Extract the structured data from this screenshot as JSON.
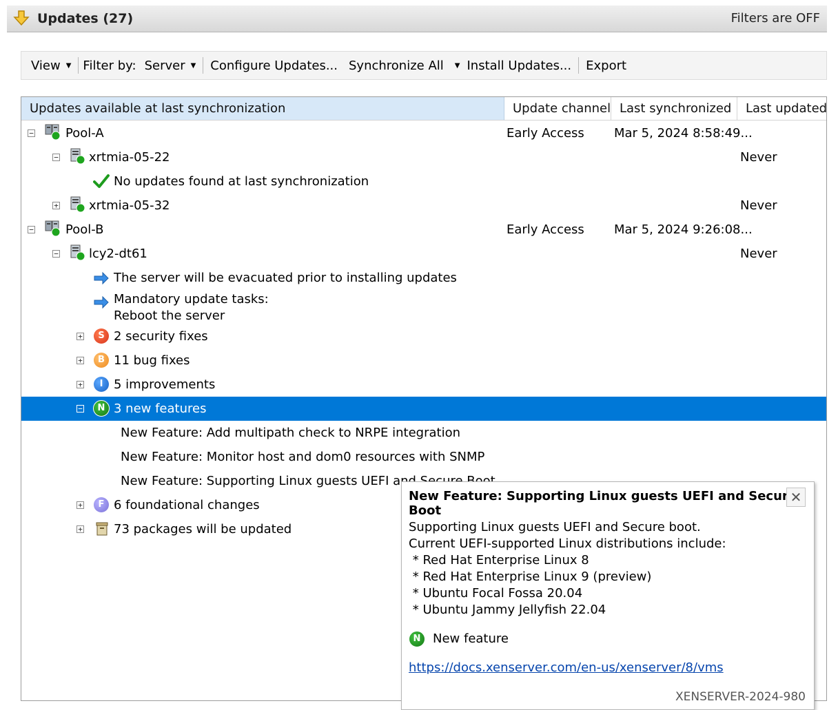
{
  "header": {
    "title": "Updates (27)",
    "filters_status": "Filters are OFF"
  },
  "toolbar": {
    "view": "View",
    "filter_by": "Filter by:",
    "server": "Server",
    "configure": "Configure Updates...",
    "sync_all": "Synchronize All",
    "install": "Install Updates...",
    "export": "Export"
  },
  "grid": {
    "columns": [
      "Updates available at last synchronization",
      "Update channel",
      "Last synchronized",
      "Last updated"
    ],
    "rows": {
      "pool_a": {
        "name": "Pool-A",
        "channel": "Early Access",
        "synced": "Mar 5, 2024 8:58:49..."
      },
      "host_0522": {
        "name": "xrtmia-05-22",
        "updated": "Never"
      },
      "no_updates": "No updates found at last synchronization",
      "host_0532": {
        "name": "xrtmia-05-32",
        "updated": "Never"
      },
      "pool_b": {
        "name": "Pool-B",
        "channel": "Early Access",
        "synced": "Mar 5, 2024 9:26:08..."
      },
      "host_dt61": {
        "name": "lcy2-dt61",
        "updated": "Never"
      },
      "evacuate": "The server will be evacuated prior to installing updates",
      "mandatory_1": "Mandatory update tasks:",
      "mandatory_2": "Reboot the server",
      "security": "2 security fixes",
      "bugs": "11 bug fixes",
      "improvements": "5 improvements",
      "features": "3 new features",
      "feature_1": "New Feature: Add multipath check to NRPE integration",
      "feature_2": "New Feature:  Monitor host and dom0 resources with SNMP",
      "feature_3": "New Feature: Supporting Linux guests UEFI and Secure Boot",
      "foundational": "6 foundational changes",
      "packages": "73 packages will be updated"
    }
  },
  "popup": {
    "title": "New Feature: Supporting Linux guests UEFI and Secure Boot",
    "lines": [
      "Supporting Linux guests UEFI and Secure boot.",
      "Current UEFI-supported Linux distributions include:",
      " * Red Hat Enterprise Linux 8",
      " * Red Hat Enterprise Linux 9 (preview)",
      " * Ubuntu Focal Fossa 20.04",
      " * Ubuntu Jammy Jellyfish 22.04"
    ],
    "type_label": "New feature",
    "link": "https://docs.xenserver.com/en-us/xenserver/8/vms",
    "id": "XENSERVER-2024-980"
  },
  "colors": {
    "selection": "#0078d7",
    "header_selected": "#d7e8f8",
    "check": "#1e9c1e",
    "info_arrow": "#3a8ee6"
  },
  "icons": [
    "down-arrow-icon",
    "pool-icon",
    "server-icon",
    "checkmark-icon",
    "info-arrow-icon",
    "security-badge-icon",
    "bug-badge-icon",
    "improvement-badge-icon",
    "new-feature-badge-icon",
    "foundational-badge-icon",
    "package-icon",
    "close-icon"
  ]
}
